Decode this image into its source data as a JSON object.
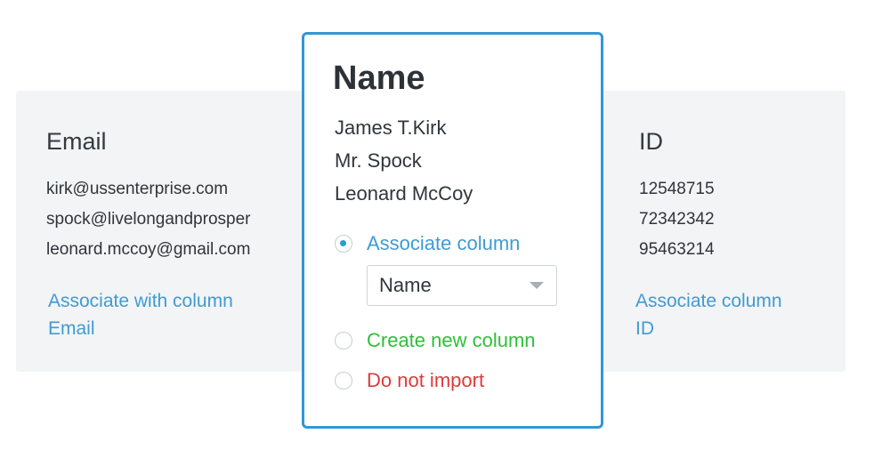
{
  "columns": {
    "email": {
      "title": "Email",
      "values": [
        "kirk@ussenterprise.com",
        "spock@livelongandprosper",
        "leonard.mccoy@gmail.com"
      ],
      "link_line1": "Associate with column",
      "link_line2": "Email"
    },
    "name": {
      "title": "Name",
      "values": [
        "James T.Kirk",
        "Mr. Spock",
        "Leonard McCoy"
      ],
      "options": {
        "associate": "Associate column",
        "create": "Create new column",
        "skip": "Do not import"
      },
      "selected_option": "associate",
      "dropdown_value": "Name"
    },
    "id": {
      "title": "ID",
      "values": [
        "12548715",
        "72342342",
        "95463214"
      ],
      "link_line1": "Associate column",
      "link_line2": "ID"
    }
  },
  "colors": {
    "accent": "#3197d6",
    "link": "#3f9bd3",
    "create": "#2fbf3a",
    "skip": "#e03a3a",
    "band": "#f3f4f5"
  },
  "icons": {
    "dropdown": "chevron-down-icon",
    "radio": "radio-icon"
  }
}
